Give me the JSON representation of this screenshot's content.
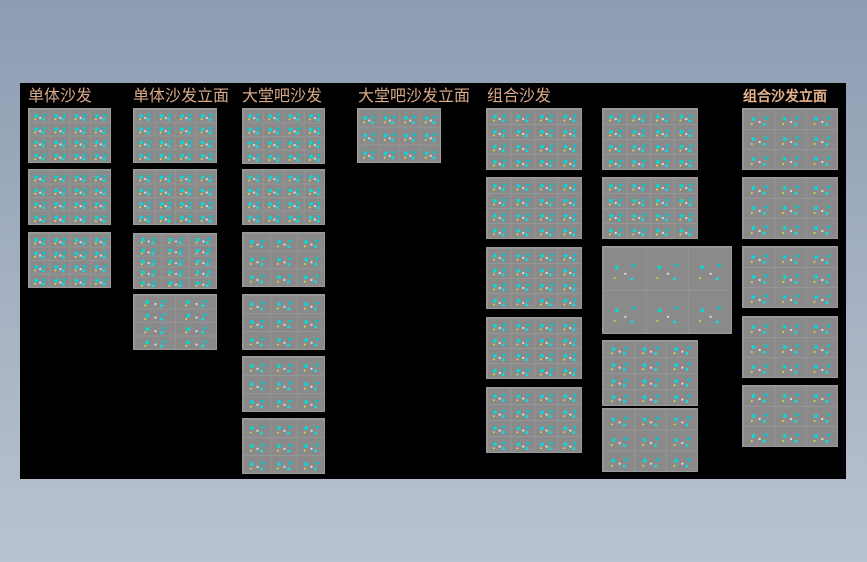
{
  "headings": {
    "single_sofa": "单体沙发",
    "single_sofa_elevation": "单体沙发立面",
    "lobby_bar_sofa": "大堂吧沙发",
    "lobby_bar_sofa_elevation": "大堂吧沙发立面",
    "combo_sofa": "组合沙发",
    "combo_sofa_elevation": "组合沙发立面"
  },
  "colors": {
    "outer_background": "#9aa7b9",
    "canvas_background": "#000000",
    "heading": "#d9a98a",
    "sheet_border": "#9a9a9a",
    "drawing_ink": "#00d8d8"
  }
}
